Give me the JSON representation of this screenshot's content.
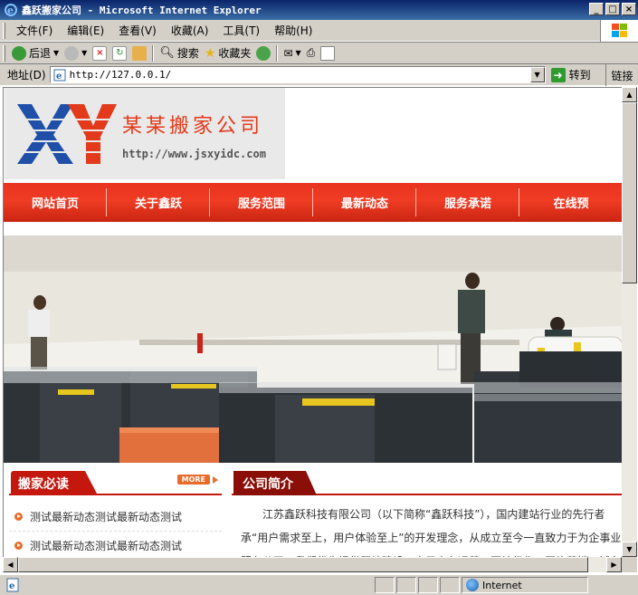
{
  "window": {
    "title": "鑫跃搬家公司 - Microsoft Internet Explorer"
  },
  "menu": [
    "文件(F)",
    "编辑(E)",
    "查看(V)",
    "收藏(A)",
    "工具(T)",
    "帮助(H)"
  ],
  "toolbar": {
    "back": "后退",
    "search": "搜索",
    "favorites": "收藏夹"
  },
  "address": {
    "label": "地址(D)",
    "url": "http://127.0.0.1/",
    "go": "转到",
    "links": "链接"
  },
  "site": {
    "logo_name": "某某搬家公司",
    "logo_url": "http://www.jsxyidc.com",
    "logo_letters": "XY",
    "nav": [
      "网站首页",
      "关于鑫跃",
      "服务范围",
      "最新动态",
      "服务承诺",
      "在线预"
    ],
    "left_box": {
      "title": "搬家必读",
      "more": "MORE",
      "items": [
        "测试最新动态测试最新动态测试",
        "测试最新动态测试最新动态测试"
      ]
    },
    "right_box": {
      "title": "公司简介",
      "lines": [
        "江苏鑫跃科技有限公司（以下简称“鑫跃科技”），国内建站行业的先行者",
        "承“用户需求至上，用户体验至上”的开发理念，从成立至今一直致力于为企事业",
        "服务公司，我们优先提供网站建设、电子商务运营、网站优化、网络营销、域名"
      ]
    }
  },
  "status": {
    "zone": "Internet"
  },
  "colors": {
    "nav_red": "#e83420",
    "box_red": "#c4180e",
    "box_dark": "#8a0f08",
    "logo_blue": "#1f4fa8",
    "logo_red": "#e23a1a"
  }
}
